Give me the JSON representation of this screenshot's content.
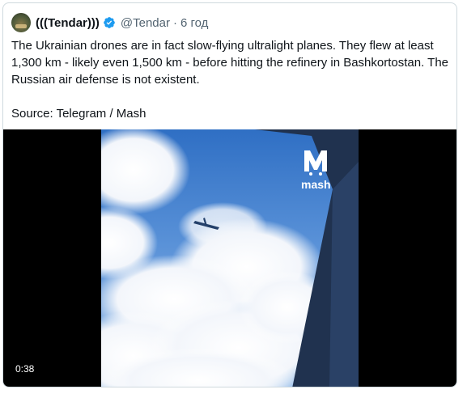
{
  "tweet": {
    "display_name": "(((Tendar)))",
    "handle": "@Tendar",
    "separator": "·",
    "timestamp": "6 год",
    "text_lines": [
      "The Ukrainian drones are in fact slow-flying ultralight planes. They flew at least",
      "1,300 km - likely even 1,500 km - before hitting the refinery in Bashkortostan. The",
      "Russian air defense is not existent."
    ],
    "source_line": "Source: Telegram / Mash"
  },
  "video": {
    "duration": "0:38",
    "watermark": "mash",
    "watermark_letter": "M"
  },
  "colors": {
    "verified_badge": "#1d9bf0",
    "text": "#0f1419",
    "muted": "#536471",
    "sky": "#3a78c9",
    "wing": "#24406a"
  },
  "icons": {
    "verified": "verified-badge-icon"
  }
}
